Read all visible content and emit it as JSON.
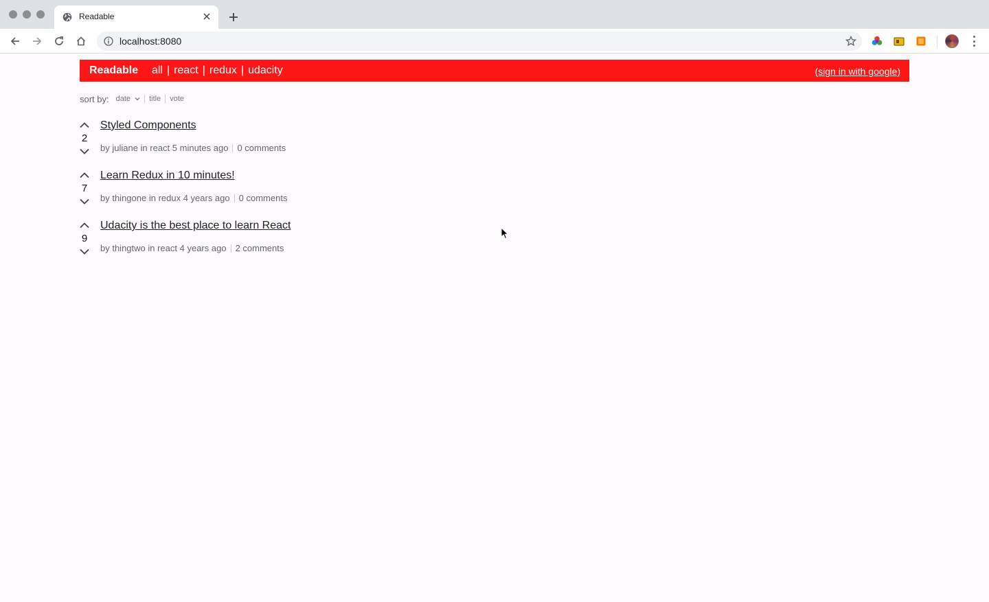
{
  "browser": {
    "tab_title": "Readable",
    "url": "localhost:8080"
  },
  "header": {
    "brand": "Readable",
    "categories": [
      "all",
      "react",
      "redux",
      "udacity"
    ],
    "signin": "(sign in with google)",
    "background_color": "#fe1616"
  },
  "sort": {
    "label": "sort by:",
    "options": [
      "date",
      "title",
      "vote"
    ],
    "selected": "date"
  },
  "posts": [
    {
      "title": "Styled Components",
      "score": "2",
      "author_line": "by juliane in react 5 minutes ago",
      "comments": "0 comments"
    },
    {
      "title": "Learn Redux in 10 minutes!",
      "score": "7",
      "author_line": "by thingone in redux 4 years ago",
      "comments": "0 comments"
    },
    {
      "title": "Udacity is the best place to learn React",
      "score": "9",
      "author_line": "by thingtwo in react 4 years ago",
      "comments": "2 comments"
    }
  ]
}
